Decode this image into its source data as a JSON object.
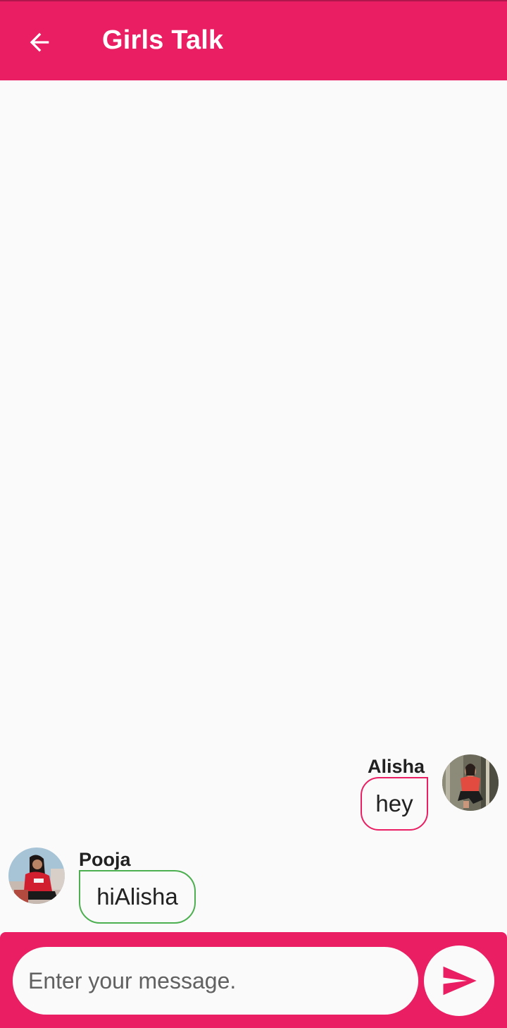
{
  "app": {
    "title": "Girls Talk",
    "accent_color": "#e91e63",
    "back_icon": "arrow-left-icon"
  },
  "messages": [
    {
      "sender": "Alisha",
      "text": "hey",
      "side": "right",
      "border_color": "#e91e63",
      "avatar": "woman-red-top-photo"
    },
    {
      "sender": "Pooja",
      "text": "hiAlisha",
      "side": "left",
      "border_color": "#4caf50",
      "avatar": "woman-red-sweater-photo"
    }
  ],
  "composer": {
    "placeholder": "Enter your message.",
    "value": "",
    "send_icon": "send-icon"
  }
}
